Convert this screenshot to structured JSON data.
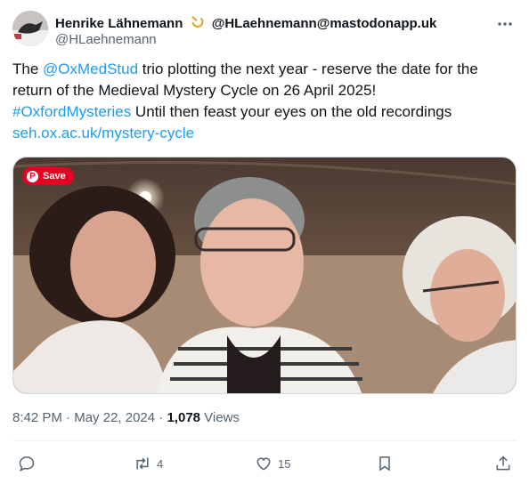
{
  "header": {
    "display_name": "Henrike Lähnemann",
    "alt_handle": "@HLaehnemann@mastodonapp.uk",
    "handle": "@HLaehnemann",
    "more_label": "···"
  },
  "tweet": {
    "t1": "The ",
    "mention": "@OxMedStud",
    "t2": " trio plotting the next year - reserve the date for the return of the Medieval Mystery Cycle on 26 April 2025!",
    "hashtag": "#OxfordMysteries",
    "t3": " Until then feast your eyes on the old recordings",
    "url": "seh.ox.ac.uk/mystery-cycle"
  },
  "media": {
    "save_label": "Save",
    "pin_glyph": "P"
  },
  "meta": {
    "time": "8:42 PM",
    "sep": " · ",
    "date": "May 22, 2024",
    "sep2": " · ",
    "views": "1,078",
    "views_label": " Views"
  },
  "actions": {
    "reply_count": "",
    "retweet_count": "4",
    "like_count": "15"
  },
  "icons": [
    "reply-icon",
    "retweet-icon",
    "like-icon",
    "bookmark-icon",
    "share-icon",
    "more-icon",
    "verified-icon"
  ]
}
